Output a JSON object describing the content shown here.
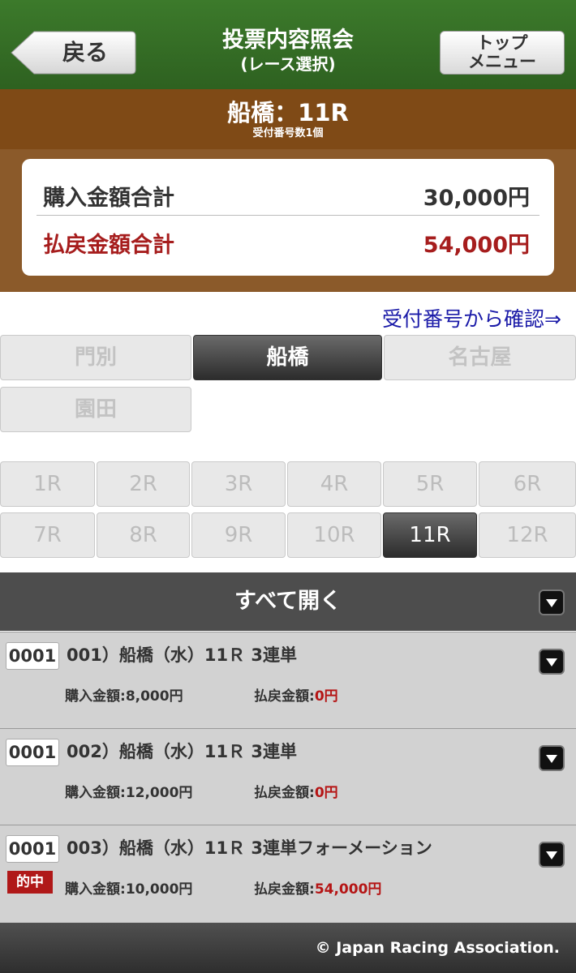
{
  "header": {
    "back_label": "戻る",
    "title_line1": "投票内容照会",
    "title_line2": "(レース選択)",
    "top_menu_line1": "トップ",
    "top_menu_line2": "メニュー"
  },
  "race": {
    "title": "船橋：11R",
    "receipt_count": "受付番号数1個"
  },
  "totals": {
    "purchase_label": "購入金額合計",
    "purchase_value": "30,000円",
    "payout_label": "払戻金額合計",
    "payout_value": "54,000円"
  },
  "confirm_link": "受付番号から確認⇒",
  "venues": [
    {
      "label": "門別",
      "active": false
    },
    {
      "label": "船橋",
      "active": true
    },
    {
      "label": "名古屋",
      "active": false
    },
    {
      "label": "園田",
      "active": false
    }
  ],
  "races": [
    {
      "label": "1R"
    },
    {
      "label": "2R"
    },
    {
      "label": "3R"
    },
    {
      "label": "4R"
    },
    {
      "label": "5R"
    },
    {
      "label": "6R"
    },
    {
      "label": "7R"
    },
    {
      "label": "8R"
    },
    {
      "label": "9R"
    },
    {
      "label": "10R"
    },
    {
      "label": "11R"
    },
    {
      "label": "12R"
    }
  ],
  "active_race": "11R",
  "open_all_label": "すべて開く",
  "tickets": [
    {
      "number": "0001",
      "desc": "001）船橋（水）11Ｒ 3連単",
      "buy_label": "購入金額:",
      "buy_amount": "8,000円",
      "pay_label": "払戻金額:",
      "pay_amount": "0円",
      "hit": ""
    },
    {
      "number": "0001",
      "desc": "002）船橋（水）11Ｒ 3連単",
      "buy_label": "購入金額:",
      "buy_amount": "12,000円",
      "pay_label": "払戻金額:",
      "pay_amount": "0円",
      "hit": ""
    },
    {
      "number": "0001",
      "desc": "003）船橋（水）11Ｒ 3連単フォーメーション",
      "buy_label": "購入金額:",
      "buy_amount": "10,000円",
      "pay_label": "払戻金額:",
      "pay_amount": "54,000円",
      "hit": "的中"
    }
  ],
  "footer": "© Japan Racing Association."
}
